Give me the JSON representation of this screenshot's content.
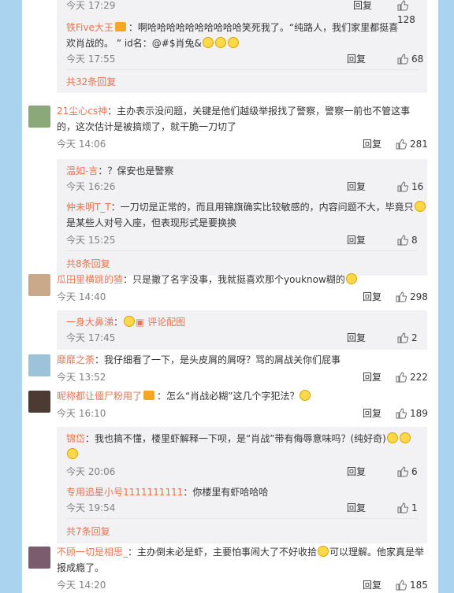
{
  "reply_label": "回复",
  "emoji_name": "face-emoji",
  "blocks": [
    {
      "type": "sub-continuation",
      "replies": [
        {
          "time": "今天 17:29",
          "likes": "128"
        },
        {
          "name": "铁Five大王",
          "badge": true,
          "text1": "：啊哈哈哈哈哈哈哈哈哈哈笑死我了。“纯路人，我们家里都挺喜",
          "text2": "欢肖战的。 ” id名：@#$肖兔&",
          "emoji_tail": 3,
          "time": "今天 17:55",
          "likes": "68"
        }
      ],
      "more": "共32条回复"
    },
    {
      "name": "21尘心cs神",
      "text1": "：主办表示没问题，关键是他们越级举报找了警察，警察一前也不管这事",
      "text2": "的，这次估计是被搞烦了，就干脆一刀切了",
      "time": "今天 14:06",
      "likes": "281",
      "replies": [
        {
          "name": "温如-言",
          "text1": "：？保安也是警察",
          "time": "今天 16:26",
          "likes": "16"
        },
        {
          "name": "仲未明T_T",
          "text1": "：一刀切是正常的，而且用锦旗确实比较敏感的，内容问题不大，毕竟只",
          "text2": "是某些人对号入座，但表现形式是要换换",
          "emoji_tail": 1,
          "time": "今天 15:25",
          "likes": "8"
        }
      ],
      "more": "共8条回复"
    },
    {
      "name": "瓜田里横跳的猹",
      "text1": "：只是撤了名字没事，我就挺喜欢那个youknow糊的",
      "emoji_tail": 1,
      "time": "今天 14:40",
      "likes": "298",
      "replies": [
        {
          "name": "一身大鼻涕",
          "text1": "：",
          "image_icon": true,
          "link": "评论配图",
          "time": "今天 17:45",
          "likes": "2"
        }
      ]
    },
    {
      "name": "靡靡之荼",
      "text1": "：我仔细看了一下，是头皮屑的屑呀？骂的屑战关你们屁事",
      "time": "今天 13:52",
      "likes": "222"
    },
    {
      "name": "昵称都让僵尸粉用了",
      "badge": true,
      "text1": "：怎么“肖战必糊”这几个字犯法？",
      "emoji_tail": 1,
      "time": "今天 16:10",
      "likes": "189",
      "replies": [
        {
          "name": "锦岱",
          "text1": "：我也搞不懂，楼里虾解释一下呗，是“肖战”带有侮辱意味吗？(纯好奇)",
          "emoji_tail": 2,
          "line2_emoji": 1,
          "time": "今天 20:06",
          "likes": "6"
        },
        {
          "name": "专用追星小号1111111111",
          "text1": "：你楼里有虾哈哈哈",
          "time": "今天 19:54",
          "likes": "1"
        }
      ],
      "more": "共7条回复"
    },
    {
      "name": "不顾一切是相思_",
      "text1": "：主办倒未必是虾，主要怕事闹大了不好收拾",
      "emoji_mid": 1,
      "text1b": "可以理解。他家真是举",
      "text2": "报成瘾了。",
      "time": "今天 14:20",
      "likes": "185"
    }
  ]
}
